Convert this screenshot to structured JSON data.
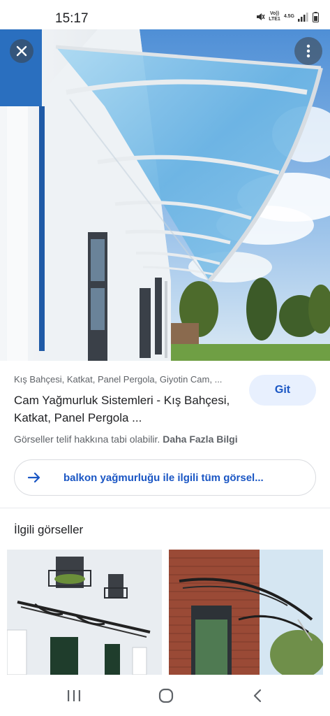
{
  "status_bar": {
    "time": "15:17",
    "network_top": "Vo))",
    "network_bottom": "LTE1",
    "network_gen": "4.5G",
    "icons": [
      "mute-icon",
      "signal-icon",
      "battery-icon"
    ]
  },
  "viewer": {
    "close_icon": "close-icon",
    "more_icon": "more-vertical-icon"
  },
  "result": {
    "source": "Kış Bahçesi, Katkat, Panel Pergola, Giyotin Cam, ...",
    "title": "Cam Yağmurluk Sistemleri - Kış Bahçesi, Katkat, Panel Pergola ...",
    "go_label": "Git",
    "copyright_text": "Görseller telif hakkına tabi olabilir.",
    "more_info": "Daha Fazla Bilgi"
  },
  "all_images": {
    "label": "balkon yağmurluğu ile ilgili tüm görsel...",
    "icon": "arrow-right-icon"
  },
  "related": {
    "heading": "İlgili görseller"
  },
  "nav_bar": {
    "icons": [
      "recent-apps-icon",
      "home-icon",
      "back-icon"
    ]
  },
  "colors": {
    "accent": "#1a56c4",
    "button_bg": "#e8f0fe",
    "secondary_text": "#5f6368"
  }
}
